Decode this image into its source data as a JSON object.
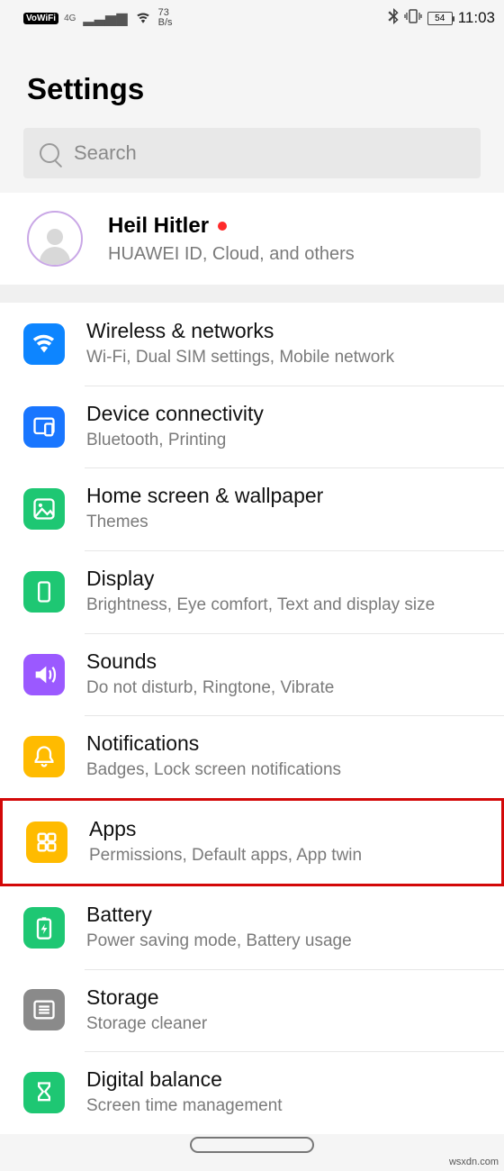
{
  "status": {
    "vowifi": "VoWiFi",
    "net_gen": "4G",
    "speed_num": "73",
    "speed_unit": "B/s",
    "battery": "54",
    "time": "11:03"
  },
  "title": "Settings",
  "search": {
    "placeholder": "Search"
  },
  "account": {
    "name": "Heil Hitler",
    "sub": "HUAWEI ID, Cloud, and others"
  },
  "items": [
    {
      "id": "wireless",
      "title": "Wireless & networks",
      "sub": "Wi-Fi, Dual SIM settings, Mobile network",
      "iconClass": "i-blue",
      "svg": "wifi"
    },
    {
      "id": "device-connectivity",
      "title": "Device connectivity",
      "sub": "Bluetooth, Printing",
      "iconClass": "i-blue2",
      "svg": "devices"
    },
    {
      "id": "home-wallpaper",
      "title": "Home screen & wallpaper",
      "sub": "Themes",
      "iconClass": "i-green",
      "svg": "picture"
    },
    {
      "id": "display",
      "title": "Display",
      "sub": "Brightness, Eye comfort, Text and display size",
      "iconClass": "i-green",
      "svg": "phone"
    },
    {
      "id": "sounds",
      "title": "Sounds",
      "sub": "Do not disturb, Ringtone, Vibrate",
      "iconClass": "i-purple",
      "svg": "speaker"
    },
    {
      "id": "notifications",
      "title": "Notifications",
      "sub": "Badges, Lock screen notifications",
      "iconClass": "i-yellow",
      "svg": "bell"
    },
    {
      "id": "apps",
      "title": "Apps",
      "sub": "Permissions, Default apps, App twin",
      "iconClass": "i-yellow",
      "svg": "grid",
      "highlight": true
    },
    {
      "id": "battery",
      "title": "Battery",
      "sub": "Power saving mode, Battery usage",
      "iconClass": "i-green",
      "svg": "battery"
    },
    {
      "id": "storage",
      "title": "Storage",
      "sub": "Storage cleaner",
      "iconClass": "i-gray",
      "svg": "list"
    },
    {
      "id": "digital-balance",
      "title": "Digital balance",
      "sub": "Screen time management",
      "iconClass": "i-green",
      "svg": "hourglass"
    }
  ],
  "watermark": "wsxdn.com"
}
